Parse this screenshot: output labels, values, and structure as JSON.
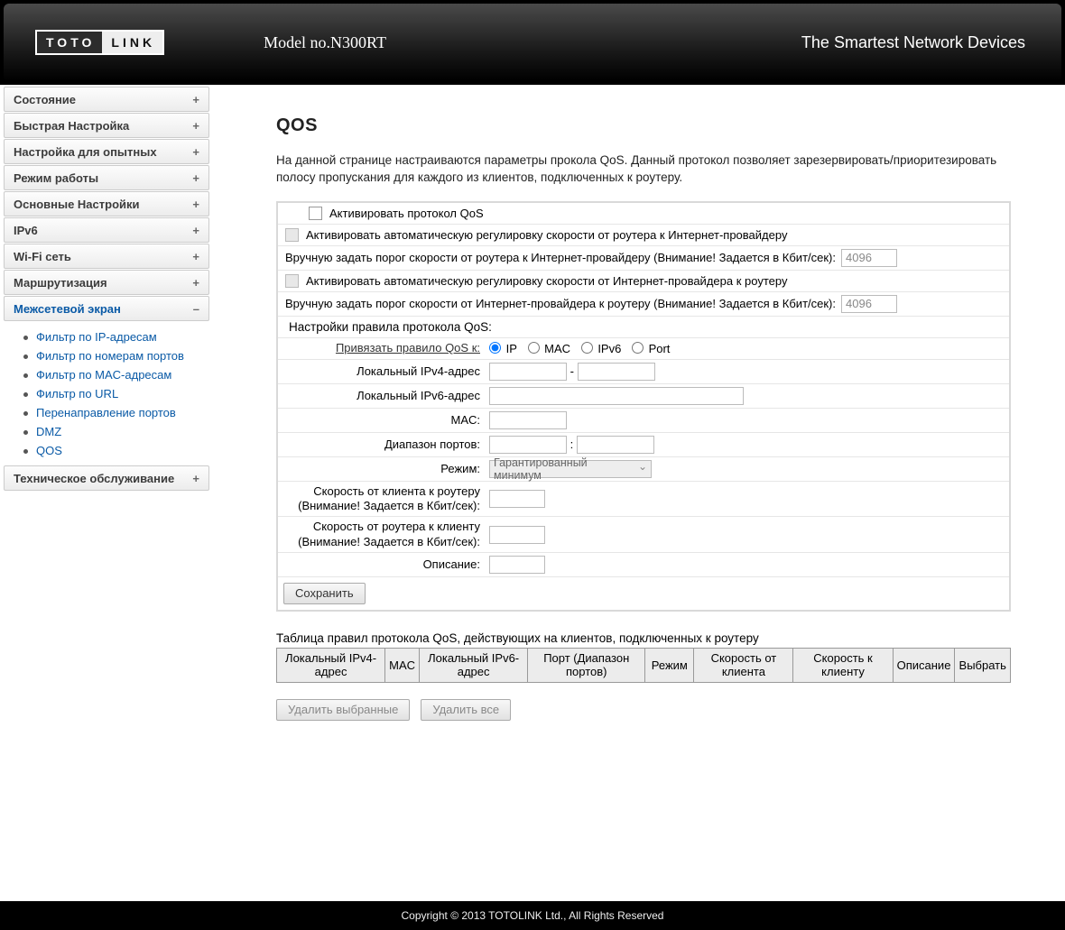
{
  "header": {
    "logo_left": "TOTO",
    "logo_right": "LINK",
    "model": "Model no.N300RT",
    "tagline": "The Smartest Network Devices"
  },
  "sidebar": {
    "items": [
      {
        "label": "Состояние",
        "sign": "+"
      },
      {
        "label": "Быстрая Настройка",
        "sign": "+"
      },
      {
        "label": "Настройка для опытных",
        "sign": "+"
      },
      {
        "label": "Режим работы",
        "sign": "+"
      },
      {
        "label": "Основные Настройки",
        "sign": "+"
      },
      {
        "label": "IPv6",
        "sign": "+"
      },
      {
        "label": "Wi-Fi сеть",
        "sign": "+"
      },
      {
        "label": "Маршрутизация",
        "sign": "+"
      },
      {
        "label": "Межсетевой экран",
        "sign": "–",
        "active": true
      },
      {
        "label": "Техническое обслуживание",
        "sign": "+"
      }
    ],
    "sub": [
      "Фильтр по IP-адресам",
      "Фильтр по номерам портов",
      "Фильтр по MAC-адресам",
      "Фильтр по URL",
      "Перенаправление портов",
      "DMZ",
      "QOS"
    ]
  },
  "page": {
    "title": "QOS",
    "intro": "На данной странице настраиваются параметры прокола QoS. Данный протокол позволяет зарезервировать/приоритезировать полосу пропускания для каждого из клиентов, подключенных к роутеру.",
    "enable_qos": "Активировать протокол QoS",
    "auto_up": "Активировать автоматическую регулировку скорости от роутера к Интернет-провайдеру",
    "manual_up": "Вручную задать порог скорости от роутера к Интернет-провайдеру (Внимание! Задается в Кбит/сек):",
    "manual_up_value": "4096",
    "auto_down": "Активировать автоматическую регулировку скорости от Интернет-провайдера к роутеру",
    "manual_down": "Вручную задать порог скорости от Интернет-провайдера к роутеру (Внимание! Задается в Кбит/сек):",
    "manual_down_value": "4096",
    "rule_header": "Настройки правила протокола QoS:",
    "bind_label": "Привязать правило QoS к:",
    "radios": {
      "ip": "IP",
      "mac": "MAC",
      "ipv6": "IPv6",
      "port": "Port"
    },
    "ipv4_label": "Локальный IPv4-адрес",
    "ipv6_label": "Локальный IPv6-адрес",
    "mac_label": "MAC:",
    "port_label": "Диапазон портов:",
    "mode_label": "Режим:",
    "mode_value": "Гарантированный минимум",
    "uplink_label": "Скорость от клиента к роутеру (Внимание! Задается в Кбит/сек):",
    "downlink_label": "Скорость от роутера к клиенту (Внимание! Задается в Кбит/сек):",
    "desc_label": "Описание:",
    "save": "Сохранить",
    "table_title": "Таблица правил протокола QoS, действующих на клиентов, подключенных к роутеру",
    "delete_selected": "Удалить выбранные",
    "delete_all": "Удалить все"
  },
  "table": {
    "cols": [
      "Локальный IPv4-адрес",
      "MAC",
      "Локальный IPv6-адрес",
      "Порт (Диапазон портов)",
      "Режим",
      "Скорость от клиента",
      "Скорость к клиенту",
      "Описание",
      "Выбрать"
    ]
  },
  "footer": "Copyright © 2013 TOTOLINK Ltd.,   All Rights Reserved"
}
